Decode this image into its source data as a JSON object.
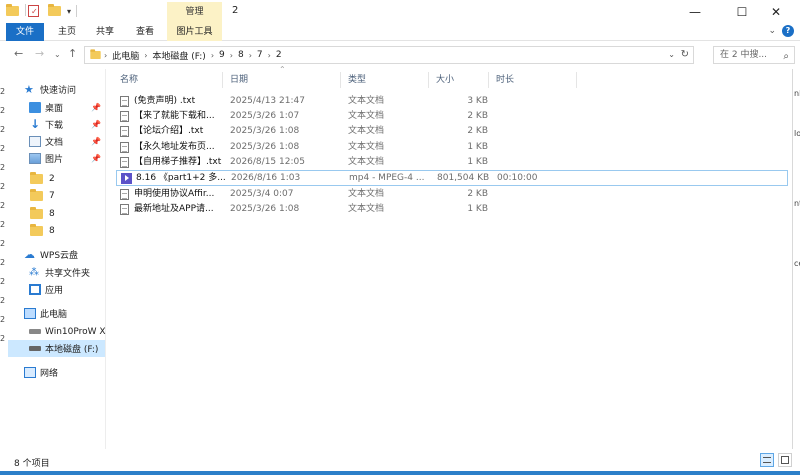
{
  "window": {
    "title": "2",
    "manage_tab": "管理",
    "controls": {
      "minimize": "—",
      "maximize": "☐",
      "close": "✕"
    }
  },
  "ribbon": {
    "tabs": [
      "文件",
      "主页",
      "共享",
      "查看",
      "图片工具"
    ],
    "file_color": "#1a6fc6",
    "picture_tools_color": "#fcf2c6"
  },
  "address": {
    "breadcrumbs": [
      "此电脑",
      "本地磁盘 (F:)",
      "9",
      "8",
      "7",
      "2"
    ],
    "search_placeholder": "在 2 中搜..."
  },
  "left_sliver": [
    "2",
    "2",
    "2",
    "2",
    "2",
    "2",
    "2",
    "2",
    "2",
    "2",
    "2",
    "2",
    "2",
    "2"
  ],
  "right_sliver": [
    "nl",
    "lo",
    "nt",
    "ce"
  ],
  "nav": {
    "quick_access": "快速访问",
    "quick_items": [
      {
        "label": "桌面",
        "icon": "desktop-icon",
        "pinned": true
      },
      {
        "label": "下载",
        "icon": "download-icon",
        "pinned": true
      },
      {
        "label": "文档",
        "icon": "document-icon",
        "pinned": true
      },
      {
        "label": "图片",
        "icon": "picture-icon",
        "pinned": true
      },
      {
        "label": "2",
        "icon": "folder-icon",
        "pinned": false
      },
      {
        "label": "7",
        "icon": "folder-icon",
        "pinned": false
      },
      {
        "label": "8",
        "icon": "folder-icon",
        "pinned": false
      },
      {
        "label": "8",
        "icon": "folder-icon",
        "pinned": false
      }
    ],
    "wps_cloud": "WPS云盘",
    "wps_items": [
      {
        "label": "共享文件夹",
        "icon": "shared-folder-icon"
      },
      {
        "label": "应用",
        "icon": "apps-icon"
      }
    ],
    "this_pc": "此电脑",
    "pc_items": [
      {
        "label": "Win10ProW X",
        "icon": "drive-icon"
      },
      {
        "label": "本地磁盘 (F:)",
        "icon": "drive-icon"
      }
    ],
    "network": "网络"
  },
  "list": {
    "columns": {
      "name": "名称",
      "date": "日期",
      "type": "类型",
      "size": "大小",
      "duration": "时长"
    },
    "files": [
      {
        "name": "(免责声明) .txt",
        "date": "2025/4/13 21:47",
        "type": "文本文档",
        "size": "3 KB",
        "duration": "",
        "icon": "text-file-icon"
      },
      {
        "name": "【来了就能下载和...",
        "date": "2025/3/26 1:07",
        "type": "文本文档",
        "size": "2 KB",
        "duration": "",
        "icon": "text-file-icon"
      },
      {
        "name": "【论坛介绍】.txt",
        "date": "2025/3/26 1:08",
        "type": "文本文档",
        "size": "2 KB",
        "duration": "",
        "icon": "text-file-icon"
      },
      {
        "name": "【永久地址发布页...",
        "date": "2025/3/26 1:08",
        "type": "文本文档",
        "size": "1 KB",
        "duration": "",
        "icon": "text-file-icon"
      },
      {
        "name": "【自用梯子推荐】.txt",
        "date": "2026/8/15 12:05",
        "type": "文本文档",
        "size": "1 KB",
        "duration": "",
        "icon": "text-file-icon"
      },
      {
        "name": "8.16 《part1+2 多...",
        "date": "2026/8/16 1:03",
        "type": "mp4 - MPEG-4 ...",
        "size": "801,504 KB",
        "duration": "00:10:00",
        "icon": "video-file-icon"
      },
      {
        "name": "申明使用协议Affir...",
        "date": "2025/3/4 0:07",
        "type": "文本文档",
        "size": "2 KB",
        "duration": "",
        "icon": "text-file-icon"
      },
      {
        "name": "最新地址及APP请...",
        "date": "2025/3/26 1:08",
        "type": "文本文档",
        "size": "1 KB",
        "duration": "",
        "icon": "text-file-icon"
      }
    ]
  },
  "status": {
    "item_count": "8 个项目"
  }
}
